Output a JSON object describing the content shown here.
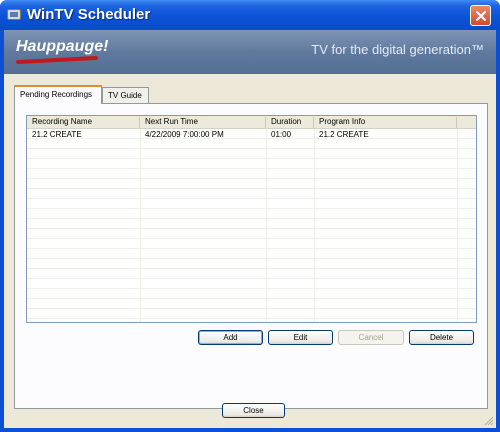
{
  "window": {
    "title": "WinTV Scheduler"
  },
  "banner": {
    "brand": "Hauppauge!",
    "tagline": "TV for the digital generation™"
  },
  "tabs": [
    {
      "label": "Pending Recordings",
      "active": true
    },
    {
      "label": "TV Guide",
      "active": false
    }
  ],
  "recordings": {
    "columns": [
      "Recording Name",
      "Next Run Time",
      "Duration",
      "Program Info"
    ],
    "rows": [
      {
        "name": "21.2  CREATE",
        "next_run": "4/22/2009 7:00:00 PM",
        "duration": "01:00",
        "program_info": "21.2  CREATE"
      }
    ]
  },
  "actions": {
    "add": "Add",
    "edit": "Edit",
    "cancel": "Cancel",
    "delete": "Delete"
  },
  "footer": {
    "close": "Close"
  },
  "colors": {
    "titlebar": "#0b53d7",
    "close_button": "#d6482b",
    "banner": "#607a9f",
    "dialog_face": "#ece9d8",
    "active_tab_accent": "#e68b2c"
  }
}
